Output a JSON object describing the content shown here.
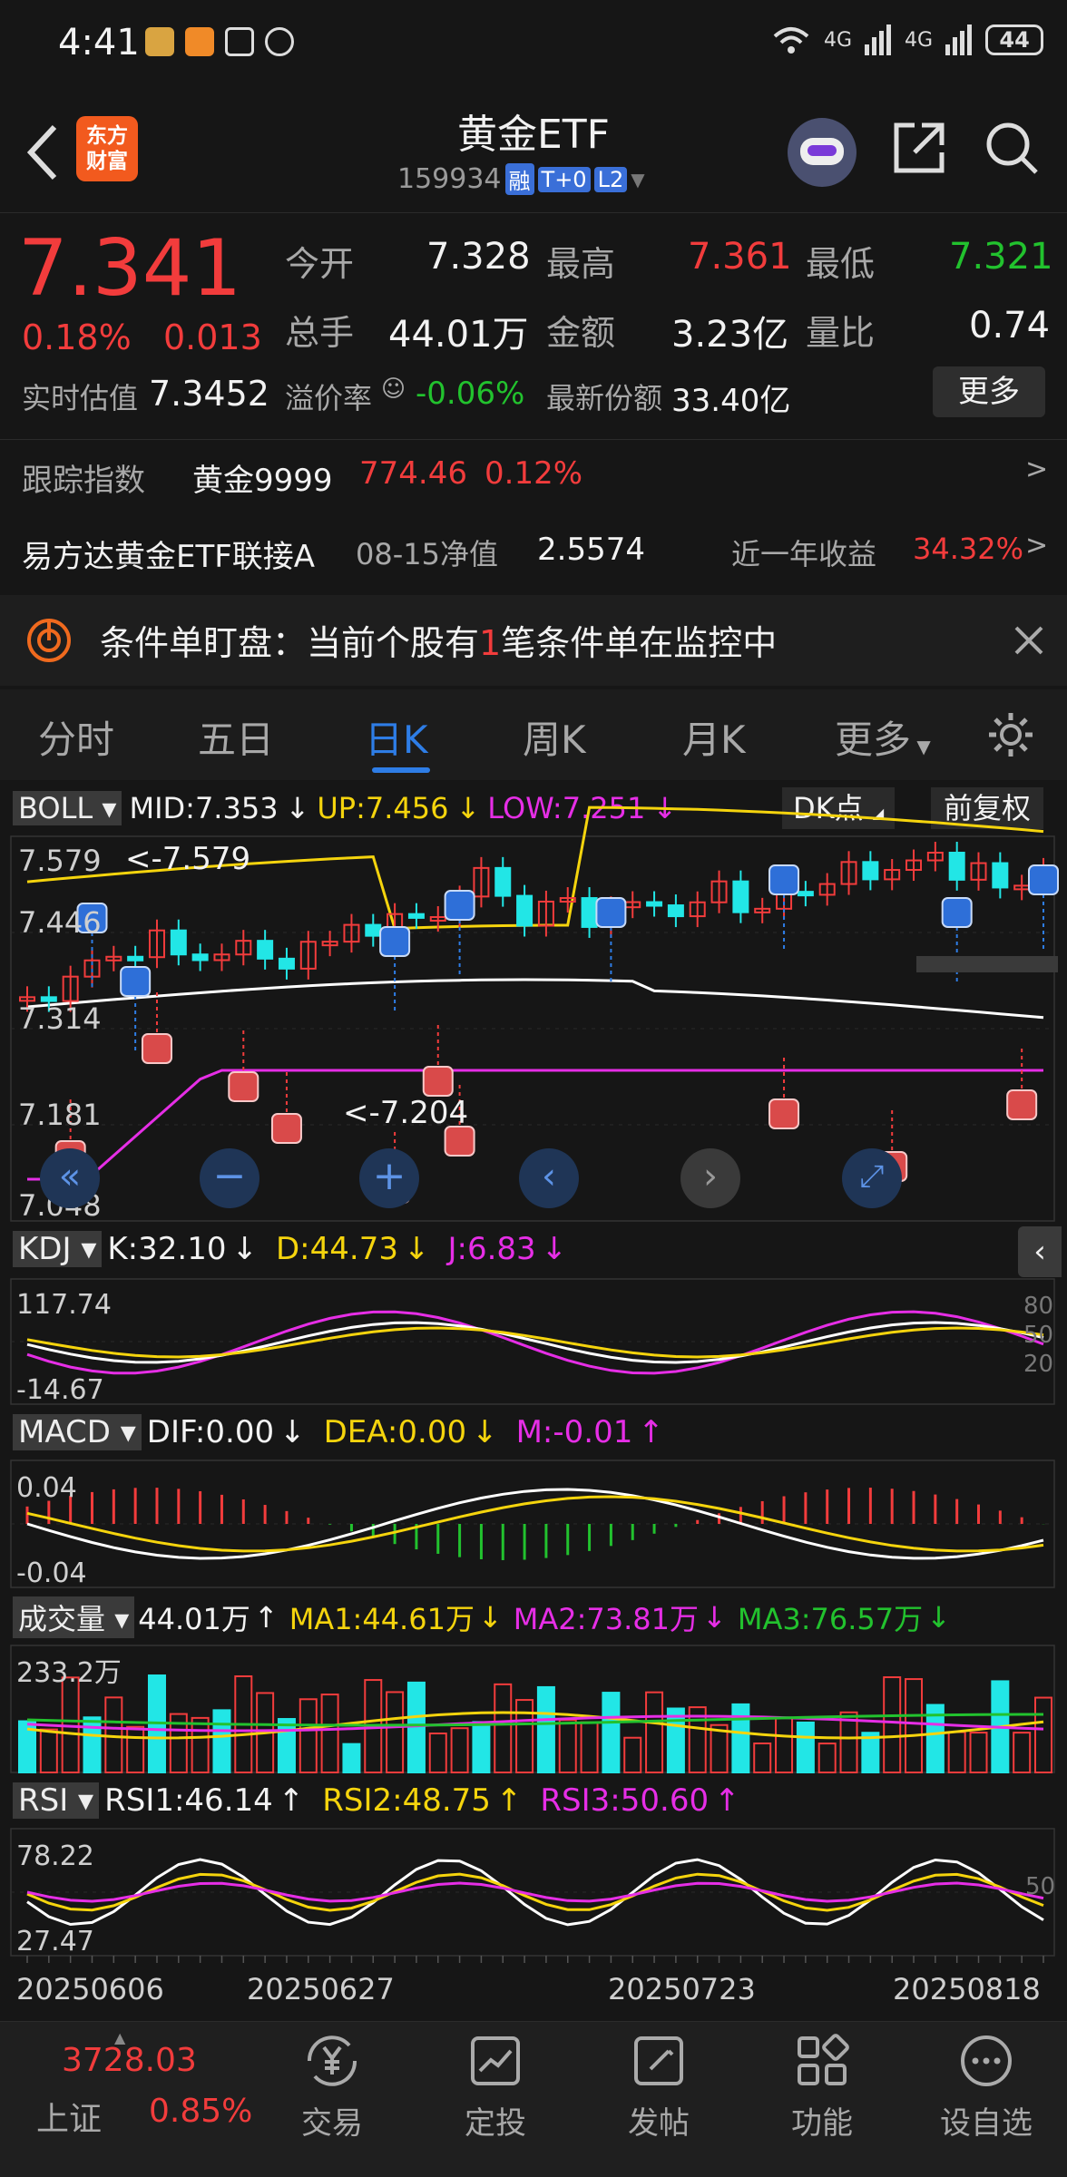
{
  "status_bar": {
    "time": "4:41",
    "battery": "44",
    "signal_a": "4G",
    "signal_b": "4G"
  },
  "header": {
    "logo_line1": "东方",
    "logo_line2": "财富",
    "title": "黄金ETF",
    "code": "159934",
    "badges": [
      "融",
      "T+0",
      "L2"
    ]
  },
  "quote": {
    "price": "7.341",
    "change_pct": "0.18%",
    "change": "0.013",
    "stats": [
      {
        "label": "今开",
        "value": "7.328",
        "tone": "white"
      },
      {
        "label": "最高",
        "value": "7.361",
        "tone": "red"
      },
      {
        "label": "最低",
        "value": "7.321",
        "tone": "green"
      },
      {
        "label": "总手",
        "value": "44.01万",
        "tone": "white"
      },
      {
        "label": "金额",
        "value": "3.23亿",
        "tone": "white"
      },
      {
        "label": "量比",
        "value": "0.74",
        "tone": "white"
      }
    ],
    "iopv_label": "实时估值",
    "iopv_value": "7.3452",
    "premium_label": "溢价率",
    "premium_value": "-0.06%",
    "shares_label": "最新份额",
    "shares_value": "33.40亿",
    "more_button": "更多"
  },
  "tracking": {
    "label": "跟踪指数",
    "index": "黄金9999",
    "value": "774.46",
    "pct": "0.12%"
  },
  "fund": {
    "name": "易方达黄金ETF联接A",
    "nav_label": "08-15净值",
    "nav": "2.5574",
    "ret_label": "近一年收益",
    "ret": "34.32%"
  },
  "notice": {
    "text_pre": "条件单盯盘：当前个股有",
    "count": "1",
    "text_post": "笔条件单在监控中"
  },
  "tabs": [
    "分时",
    "五日",
    "日K",
    "周K",
    "月K",
    "更多"
  ],
  "active_tab": "日K",
  "boll": {
    "name": "BOLL",
    "mid": "MID:7.353",
    "up": "UP:7.456",
    "low": "LOW:7.251",
    "dk": "DK点",
    "fq": "前复权",
    "y_labels": [
      "7.579",
      "7.446",
      "7.314",
      "7.181",
      "7.048"
    ],
    "high_note": "<-7.579",
    "low_note": "<-7.204"
  },
  "kdj": {
    "name": "KDJ",
    "k": "K:32.10",
    "d": "D:44.73",
    "j": "J:6.83",
    "y_top": "117.74",
    "y_bot": "-14.67",
    "right_labels": [
      "80",
      "50",
      "20"
    ]
  },
  "macd": {
    "name": "MACD",
    "dif": "DIF:0.00",
    "dea": "DEA:0.00",
    "m": "M:-0.01",
    "y_top": "0.04",
    "y_bot": "-0.04"
  },
  "vol": {
    "name": "成交量",
    "v": "44.01万",
    "ma1": "MA1:44.61万",
    "ma2": "MA2:73.81万",
    "ma3": "MA3:76.57万",
    "y_top": "233.2万"
  },
  "rsi": {
    "name": "RSI",
    "r1": "RSI1:46.14",
    "r2": "RSI2:48.75",
    "r3": "RSI3:50.60",
    "y_top": "78.22",
    "y_bot": "27.47",
    "right_label": "50"
  },
  "dates": [
    "20250606",
    "20250627",
    "20250723",
    "20250818"
  ],
  "arrow_up": "↑",
  "arrow_down": "↓",
  "bottom": {
    "sh_value": "3728.03",
    "sh_label": "上证",
    "sh_pct": "0.85%",
    "items": [
      {
        "label": "交易",
        "icon": "yen-exchange-icon"
      },
      {
        "label": "定投",
        "icon": "chart-trend-icon"
      },
      {
        "label": "发帖",
        "icon": "compose-icon"
      },
      {
        "label": "功能",
        "icon": "grid-icon"
      },
      {
        "label": "设自选",
        "icon": "more-dots-icon"
      }
    ]
  },
  "colors": {
    "up": "#f23c3c",
    "down": "#22e6e6",
    "mid": "#ffffff",
    "upper": "#f5d40d",
    "lower": "#e62ee6",
    "ma3": "#22c22e",
    "accent": "#2e7de6"
  },
  "chart_data": {
    "type": "candlestick",
    "x_range": [
      "20250606",
      "20250818"
    ],
    "y_range": [
      7.048,
      7.579
    ],
    "marked_high": 7.579,
    "marked_low": 7.204,
    "last_close": 7.341,
    "boll": {
      "mid": 7.353,
      "up": 7.456,
      "low": 7.251
    },
    "kdj": {
      "k": 32.1,
      "d": 44.73,
      "j": 6.83,
      "range": [
        -14.67,
        117.74
      ]
    },
    "macd": {
      "dif": 0.0,
      "dea": 0.0,
      "m": -0.01,
      "range": [
        -0.04,
        0.04
      ]
    },
    "volume": {
      "last": "44.01万",
      "ma1": "44.61万",
      "ma2": "73.81万",
      "ma3": "76.57万",
      "max": "233.2万"
    },
    "rsi": {
      "rsi1": 46.14,
      "rsi2": 48.75,
      "rsi3": 50.6,
      "range": [
        27.47,
        78.22
      ]
    }
  }
}
